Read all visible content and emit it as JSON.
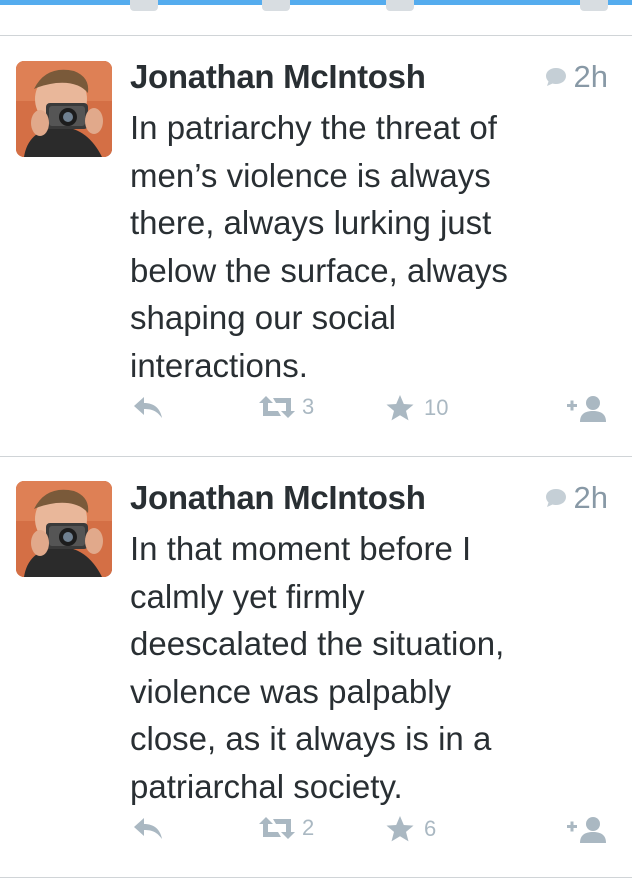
{
  "colors": {
    "accent": "#55acee",
    "text": "#292f33",
    "muted": "#8899a6",
    "icon": "#aab8c2",
    "divider": "#d0d4d7"
  },
  "tweets": [
    {
      "author": "Jonathan McIntosh",
      "time": "2h",
      "text": "In patriarchy the threat of\nmen’s violence is always\nthere, always lurking just\nbelow the surface, always\nshaping our social\ninteractions.",
      "retweets": "3",
      "favorites": "10",
      "icons": [
        "reply-icon",
        "retweet-icon",
        "star-icon",
        "follow-icon",
        "speech-bubble-icon"
      ]
    },
    {
      "author": "Jonathan McIntosh",
      "time": "2h",
      "text": "In that moment before I\ncalmly yet firmly\ndeescalated the situation,\nviolence was palpably\nclose, as it always is in a\npatriarchal society.",
      "retweets": "2",
      "favorites": "6",
      "icons": [
        "reply-icon",
        "retweet-icon",
        "star-icon",
        "follow-icon",
        "speech-bubble-icon"
      ]
    }
  ]
}
